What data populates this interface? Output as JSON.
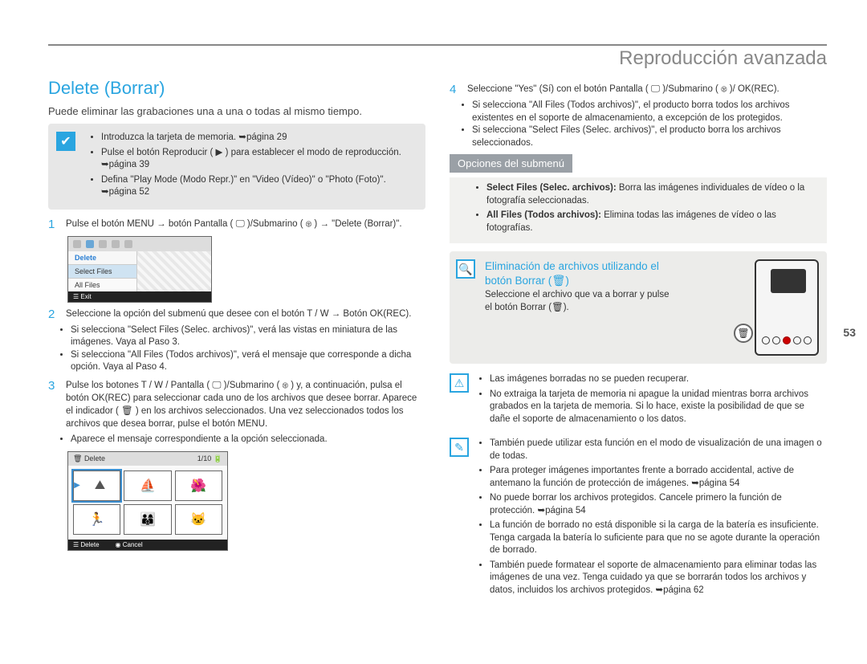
{
  "header": {
    "section_title": "Reproducción avanzada"
  },
  "page_number": "53",
  "left": {
    "title": "Delete (Borrar)",
    "lead": "Puede eliminar las grabaciones una a una o todas al mismo tiempo.",
    "prebox": {
      "items": [
        "Introduzca la tarjeta de memoria. ➥página 29",
        "Pulse el botón Reproducir ( ▶ ) para establecer el modo de reproducción. ➥página 39",
        "Defina \"Play Mode (Modo Repr.)\" en \"Video (Vídeo)\" o \"Photo (Foto)\". ➥página 52"
      ]
    },
    "step1": "Pulse el botón MENU → botón Pantalla ( 🖵 )/Submarino ( ⊛ ) → \"Delete (Borrar)\".",
    "ui1": {
      "header": "Delete",
      "opt_sel": "Select Files",
      "opt_all": "All Files",
      "exit": "Exit"
    },
    "step2": "Seleccione la opción del submenú que desee con el botón T / W → Botón OK(REC).",
    "step2_b1": "Si selecciona \"Select Files (Selec. archivos)\", verá las vistas en miniatura de las imágenes. Vaya al Paso 3.",
    "step2_b2": "Si selecciona \"All Files (Todos archivos)\", verá el mensaje que corresponde a dicha opción. Vaya al Paso 4.",
    "step3": "Pulse los botones T / W / Pantalla ( 🖵 )/Submarino ( ⊛ ) y, a continuación, pulsa el botón OK(REC) para seleccionar cada uno de los archivos que desee borrar. Aparece el indicador ( 🗑 ) en los archivos seleccionados. Una vez seleccionados todos los archivos que desea borrar, pulse el botón MENU.",
    "step3_b1": "Aparece el mensaje correspondiente a la opción seleccionada.",
    "ui2": {
      "title": "Delete",
      "counter": "1/10",
      "foot_del": "Delete",
      "foot_cancel": "Cancel"
    }
  },
  "right": {
    "step4": "Seleccione \"Yes\" (Sí) con el botón Pantalla ( 🖵 )/Submarino ( ⊛ )/ OK(REC).",
    "step4_b1": "Si selecciona \"All Files (Todos archivos)\", el producto borra todos los archivos existentes en el soporte de almacenamiento, a excepción de los protegidos.",
    "step4_b2": "Si selecciona \"Select Files (Selec. archivos)\", el producto borra los archivos seleccionados.",
    "submenu_label": "Opciones del submenú",
    "submenu_b1_label": "Select Files (Selec. archivos):",
    "submenu_b1_text": " Borra las imágenes individuales de vídeo o la fotografía seleccionadas.",
    "submenu_b2_label": "All Files (Todos archivos):",
    "submenu_b2_text": " Elimina todas las imágenes de vídeo o las fotografías.",
    "tip_title_l1": "Eliminación de archivos utilizando el",
    "tip_title_l2": "botón Borrar (🗑)",
    "tip_text_l1": "Seleccione el archivo que va a borrar y pulse",
    "tip_text_l2": "el botón Borrar (🗑).",
    "warn_b1": "Las imágenes borradas no se pueden recuperar.",
    "warn_b2": "No extraiga la tarjeta de memoria ni apague la unidad mientras borra archivos grabados en la tarjeta de memoria. Si lo hace, existe la posibilidad de que se dañe el soporte de almacenamiento o los datos.",
    "note_b1": "También puede utilizar esta función en el modo de visualización de una imagen o de todas.",
    "note_b2": "Para proteger imágenes importantes frente a borrado accidental, active de antemano la función de protección de imágenes. ➥página 54",
    "note_b3": "No puede borrar los archivos protegidos. Cancele primero la función de protección. ➥página 54",
    "note_b4": "La función de borrado no está disponible si la carga de la batería es insuficiente. Tenga cargada la batería lo suficiente para que no se agote durante la operación de borrado.",
    "note_b5": "También puede formatear el soporte de almacenamiento para eliminar todas las imágenes de una vez. Tenga cuidado ya que se borrarán todos los archivos y datos, incluidos los archivos protegidos. ➥página 62"
  }
}
